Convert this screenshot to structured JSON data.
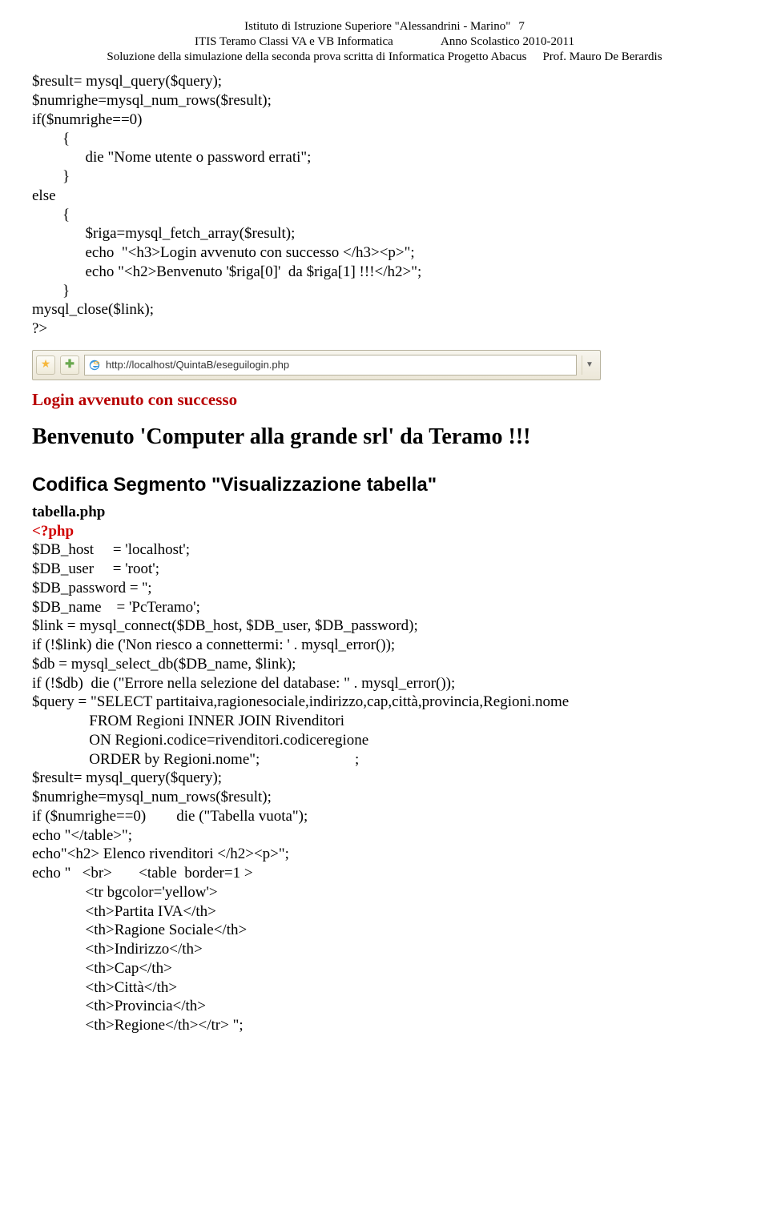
{
  "header": {
    "line1_left": "Istituto di Istruzione Superiore \"Alessandrini - Marino\"",
    "pagenum": "7",
    "line2_left": "ITIS Teramo Classi VA e VB Informatica",
    "line2_right": "Anno Scolastico 2010-2011",
    "line3_left": "Soluzione della simulazione della seconda prova scritta di Informatica  Progetto Abacus",
    "line3_right": "Prof. Mauro De Berardis"
  },
  "code1": "$result= mysql_query($query);\n$numrighe=mysql_num_rows($result);\nif($numrighe==0)\n        {\n              die \"Nome utente o password errati\";\n        }\nelse\n        {\n              $riga=mysql_fetch_array($result);\n              echo  \"<h3>Login avvenuto con successo </h3><p>\";\n              echo \"<h2>Benvenuto '$riga[0]'  da $riga[1] !!!</h2>\";\n        }\nmysql_close($link);\n?>",
  "browser": {
    "url": "http://localhost/QuintaB/eseguilogin.php",
    "h3": "Login avvenuto con successo",
    "h2": "Benvenuto 'Computer alla grande srl' da Teramo !!!"
  },
  "section_title": "Codifica Segmento \"Visualizzazione tabella\"",
  "filename": "tabella.php",
  "phpopen": "<?php",
  "code2": "$DB_host     = 'localhost';\n$DB_user     = 'root';\n$DB_password = '';\n$DB_name    = 'PcTeramo';\n$link = mysql_connect($DB_host, $DB_user, $DB_password);\nif (!$link) die ('Non riesco a connettermi: ' . mysql_error());\n$db = mysql_select_db($DB_name, $link);\nif (!$db)  die (\"Errore nella selezione del database: \" . mysql_error());\n$query = \"SELECT partitaiva,ragionesociale,indirizzo,cap,città,provincia,Regioni.nome\n               FROM Regioni INNER JOIN Rivenditori\n               ON Regioni.codice=rivenditori.codiceregione\n               ORDER by Regioni.nome\";                         ;\n$result= mysql_query($query);\n$numrighe=mysql_num_rows($result);\nif ($numrighe==0)        die (\"Tabella vuota\");\necho \"</table>\";\necho\"<h2> Elenco rivenditori </h2><p>\";\necho \"   <br>       <table  border=1 >\n              <tr bgcolor='yellow'>\n              <th>Partita IVA</th>\n              <th>Ragione Sociale</th>\n              <th>Indirizzo</th>\n              <th>Cap</th>\n              <th>Città</th>\n              <th>Provincia</th>\n              <th>Regione</th></tr> \";"
}
